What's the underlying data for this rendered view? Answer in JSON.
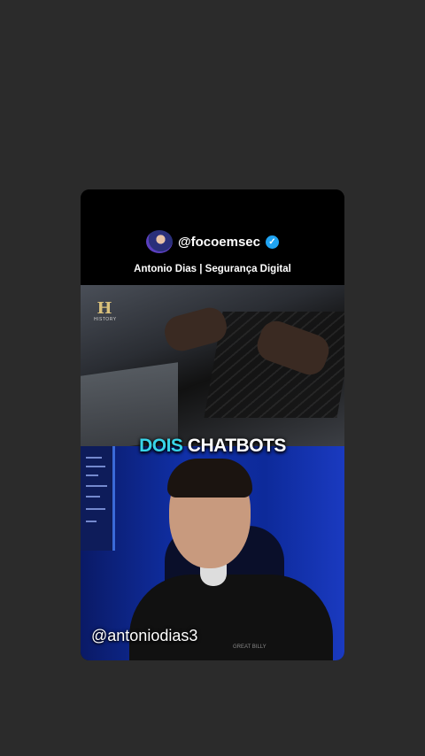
{
  "header": {
    "handle": "@focoemsec",
    "subtitle": "Antonio Dias | Segurança Digital"
  },
  "clip": {
    "logo_letter": "H",
    "logo_text": "HISTORY"
  },
  "caption": {
    "word1": "DOIS",
    "word2": "CHATBOTS"
  },
  "webcam": {
    "username": "@antoniodias3",
    "shirt_brand": "GREAT BILLY"
  },
  "colors": {
    "background": "#2b2b2b",
    "caption_accent": "#38d4e8",
    "verified": "#20a4f3"
  }
}
